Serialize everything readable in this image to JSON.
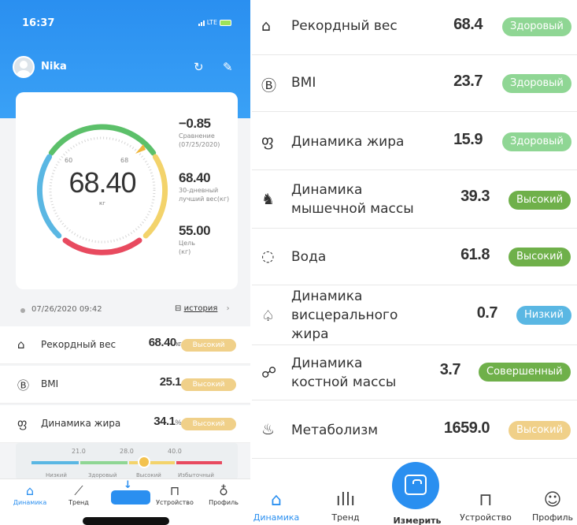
{
  "left": {
    "status": {
      "time": "16:37",
      "network": "LTE"
    },
    "user": {
      "name": "Nika"
    },
    "gauge": {
      "value": "68.40",
      "unit": "кг",
      "tick_a": "60",
      "tick_b": "68"
    },
    "stats": [
      {
        "value": "−0.85",
        "label_1": "Сравнение",
        "label_2": "(07/25/2020)"
      },
      {
        "value": "68.40",
        "label_1": "30-дневный",
        "label_2": "лучший вес(кг)"
      },
      {
        "value": "55.00",
        "label_1": "Цель",
        "label_2": "(кг)"
      }
    ],
    "date": "07/26/2020 09:42",
    "history_link": "история",
    "metrics": [
      {
        "name": "Рекордный вес",
        "value": "68.40",
        "unit": "кг",
        "badge": "Высокий"
      },
      {
        "name": "BMI",
        "value": "25.1",
        "unit": "",
        "badge": "Высокий"
      },
      {
        "name": "Динамика жира",
        "value": "34.1",
        "unit": "%",
        "badge": "Высокий"
      }
    ],
    "scale": {
      "ticks": [
        "21.0",
        "28.0",
        "40.0"
      ],
      "categories": [
        "Низкий",
        "Здоровый",
        "Высокий",
        "Избыточный"
      ]
    },
    "tabs": [
      "Динамика",
      "Тренд",
      "Устройство",
      "Профиль"
    ]
  },
  "right": {
    "metrics": [
      {
        "name_1": "Рекордный вес",
        "name_2": "",
        "name_3": "",
        "value": "68.4",
        "badge": "Здоровый",
        "badge_color": "#8fd694"
      },
      {
        "name_1": "BMI",
        "name_2": "",
        "name_3": "",
        "value": "23.7",
        "badge": "Здоровый",
        "badge_color": "#8fd694"
      },
      {
        "name_1": "Динамика жира",
        "name_2": "",
        "name_3": "",
        "value": "15.9",
        "badge": "Здоровый",
        "badge_color": "#8fd694"
      },
      {
        "name_1": "Динамика",
        "name_2": "мышечной массы",
        "name_3": "",
        "value": "39.3",
        "badge": "Высокий",
        "badge_color": "#6fb04a"
      },
      {
        "name_1": "Вода",
        "name_2": "",
        "name_3": "",
        "value": "61.8",
        "badge": "Высокий",
        "badge_color": "#6fb04a"
      },
      {
        "name_1": "Динамика",
        "name_2": "висцерального",
        "name_3": "жира",
        "value": "0.7",
        "badge": "Низкий",
        "badge_color": "#5ab7e3"
      },
      {
        "name_1": "Динамика",
        "name_2": "костной массы",
        "name_3": "",
        "value": "3.7",
        "badge": "Совершенный",
        "badge_color": "#6fb04a"
      },
      {
        "name_1": "Метаболизм",
        "name_2": "",
        "name_3": "",
        "value": "1659.0",
        "badge": "Высокий",
        "badge_color": "#f0d089"
      }
    ],
    "tabs": {
      "dynamics": "Динамика",
      "trend": "Тренд",
      "measure": "Измерить",
      "device": "Устройство",
      "profile": "Профиль"
    }
  },
  "colors": {
    "accent": "#2a8ff0",
    "healthy": "#8fd694",
    "high": "#6fb04a",
    "low": "#5ab7e3",
    "warn": "#f0d089",
    "gauge_red": "#e84a5f",
    "gauge_green": "#5cc06a",
    "gauge_yellow": "#f3d36b",
    "gauge_blue": "#5ab7e3"
  }
}
